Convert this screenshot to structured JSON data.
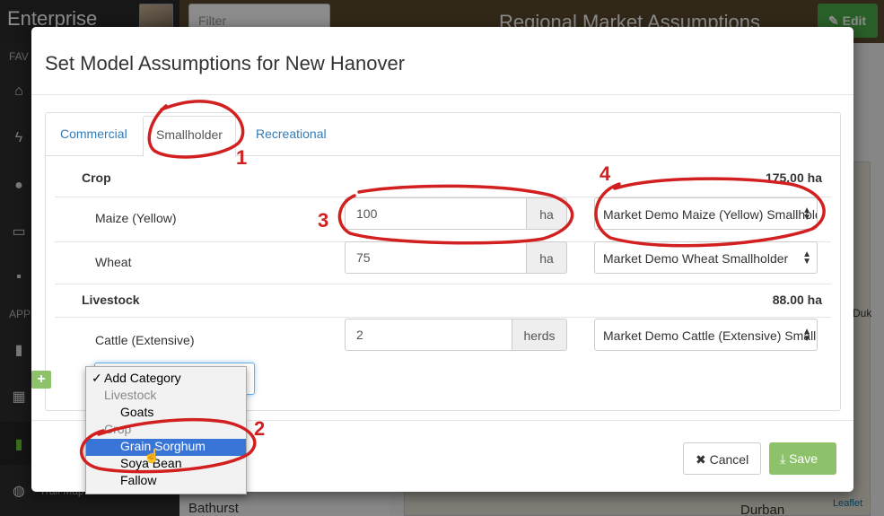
{
  "app": {
    "brand": "Enterprise",
    "filter_placeholder": "Filter",
    "page_title": "Regional Market Assumptions",
    "edit_label": "Edit",
    "sidebar_fav": "FAV",
    "sidebar_app": "APP",
    "trail_map": "Trail Map",
    "bathurst": "Bathurst"
  },
  "map": {
    "duk": "Duk",
    "durban": "Durban",
    "attribution": "Leaflet"
  },
  "modal": {
    "title": "Set Model Assumptions for New Hanover",
    "tabs": [
      "Commercial",
      "Smallholder",
      "Recreational"
    ],
    "active_tab": "Smallholder",
    "crop": {
      "label": "Crop",
      "total": "175.00 ha",
      "items": [
        {
          "name": "Maize (Yellow)",
          "value": "100",
          "unit": "ha",
          "market": "Market Demo Maize (Yellow) Smallholder"
        },
        {
          "name": "Wheat",
          "value": "75",
          "unit": "ha",
          "market": "Market Demo Wheat Smallholder"
        }
      ]
    },
    "livestock": {
      "label": "Livestock",
      "total": "88.00 ha",
      "items": [
        {
          "name": "Cattle (Extensive)",
          "value": "2",
          "unit": "herds",
          "market": "Market Demo Cattle (Extensive) Smallholder"
        }
      ]
    },
    "add_button": "+",
    "cancel_label": "Cancel",
    "save_label": "Save"
  },
  "dropdown": {
    "checked": "Add Category",
    "group_livestock": "Livestock",
    "goats": "Goats",
    "group_crop": "Crop",
    "grain_sorghum": "Grain Sorghum",
    "soya_bean": "Soya Bean",
    "fallow": "Fallow",
    "selected": "Grain Sorghum"
  },
  "annotations": [
    "1",
    "2",
    "3",
    "4"
  ],
  "colors": {
    "annotation": "#d21f1f",
    "save": "#8dc26b",
    "edit": "#4cae4c",
    "link": "#337ab7",
    "dropdown_highlight": "#3875d7"
  }
}
